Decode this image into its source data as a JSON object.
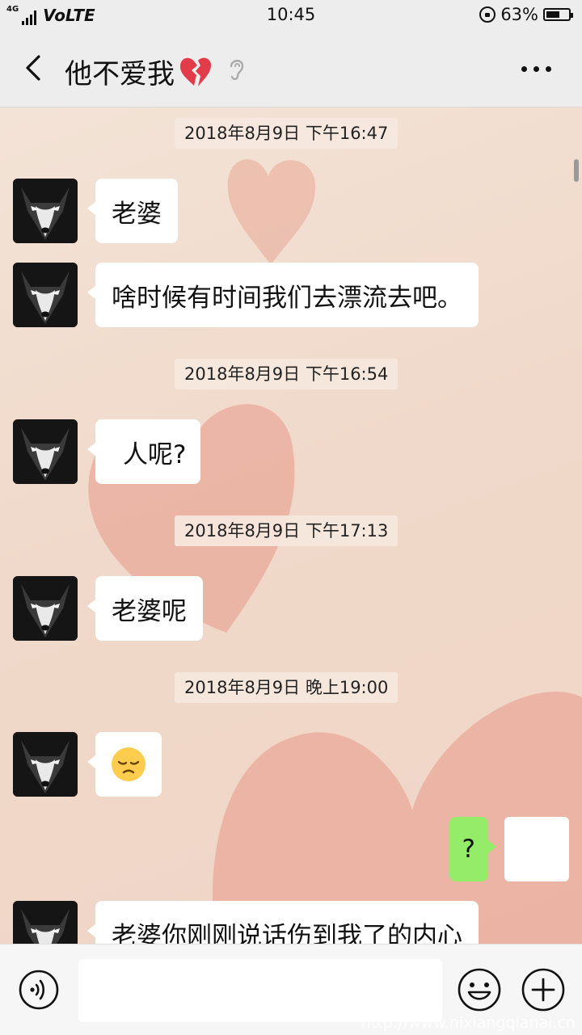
{
  "status_bar": {
    "network": "4G",
    "carrier": "VoLTE",
    "time": "10:45",
    "battery_percent": "63%",
    "battery_level": 0.63
  },
  "header": {
    "title": "他不爱我",
    "back_icon": "chevron-left-icon",
    "title_icon": "broken-heart-icon",
    "earpiece_icon": "ear-icon",
    "more_icon": "more-dots-icon"
  },
  "messages": {
    "ts1": "2018年8月9日 下午16:47",
    "m1": "老婆",
    "m2": "啥时候有时间我们去漂流去吧。",
    "ts2": "2018年8月9日 下午16:54",
    "m3": "人呢?",
    "ts3": "2018年8月9日 下午17:13",
    "m4": "老婆呢",
    "ts4": "2018年8月9日 晚上19:00",
    "m5_emoji": "pensive-face-icon",
    "m6_me": "?",
    "m7": "老婆你刚刚说话伤到我了的内心"
  },
  "input_bar": {
    "voice_icon": "voice-icon",
    "text_value": "",
    "emoji_icon": "smiley-icon",
    "plus_icon": "plus-icon"
  },
  "watermark": "http://www.nixiangqianai.cn",
  "colors": {
    "my_bubble": "#95ec69",
    "their_bubble": "#ffffff",
    "header_bg": "#ededed"
  }
}
